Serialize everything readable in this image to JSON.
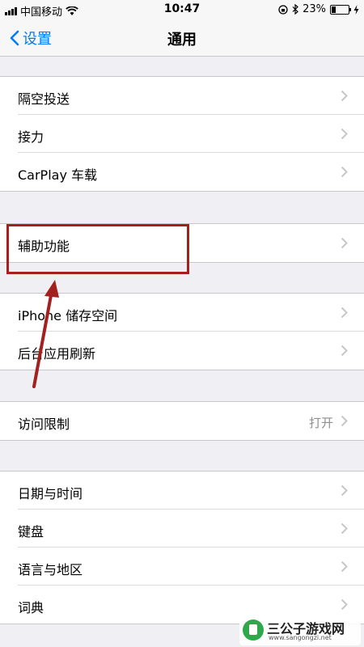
{
  "status_bar": {
    "carrier": "中国移动",
    "time": "10:47",
    "battery_percent": "23%"
  },
  "nav": {
    "back_label": "设置",
    "title": "通用"
  },
  "groups": [
    {
      "items": [
        {
          "label": "隔空投送"
        },
        {
          "label": "接力"
        },
        {
          "label": "CarPlay 车载"
        }
      ]
    },
    {
      "items": [
        {
          "label": "辅助功能"
        }
      ]
    },
    {
      "items": [
        {
          "label": "iPhone 储存空间"
        },
        {
          "label": "后台应用刷新"
        }
      ]
    },
    {
      "items": [
        {
          "label": "访问限制",
          "value": "打开"
        }
      ]
    },
    {
      "items": [
        {
          "label": "日期与时间"
        },
        {
          "label": "键盘"
        },
        {
          "label": "语言与地区"
        },
        {
          "label": "词典"
        }
      ]
    }
  ],
  "watermark": {
    "text": "三公子游戏网",
    "url": "www.sangongzi.net"
  },
  "colors": {
    "accent": "#007aff",
    "highlight": "#a4201f",
    "background": "#efeff4"
  }
}
